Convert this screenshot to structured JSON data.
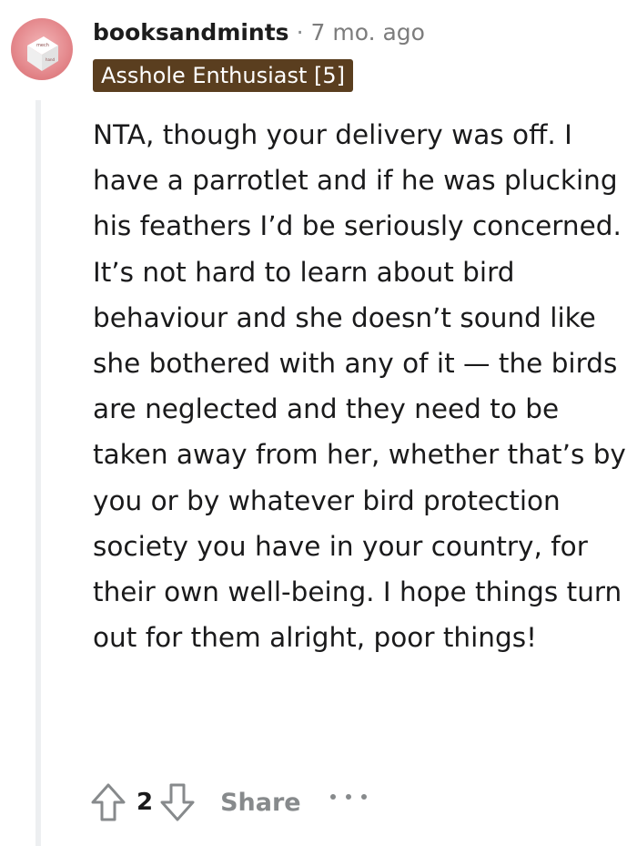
{
  "comment": {
    "username": "booksandmints",
    "separator": "·",
    "timestamp": "7 mo. ago",
    "flair": "Asshole Enthusiast [5]",
    "flair_color": "#5a3e1f",
    "avatar_icon": "dice-avatar-icon",
    "body": "NTA, though your delivery was off. I have a parrotlet and if he was plucking his feathers I’d be seriously concerned. It’s not hard to learn about bird behaviour and she doesn’t sound like she bothered with any of it — the birds are neglected and they need to be taken away from her, whether that’s by you or by whatever bird protection society you have in your country, for their own well-being. I hope things turn out for them alright, poor things!"
  },
  "actions": {
    "upvote_icon": "upvote-arrow-icon",
    "score": "2",
    "downvote_icon": "downvote-arrow-icon",
    "share_label": "Share",
    "more_icon": "more-dots-icon"
  }
}
